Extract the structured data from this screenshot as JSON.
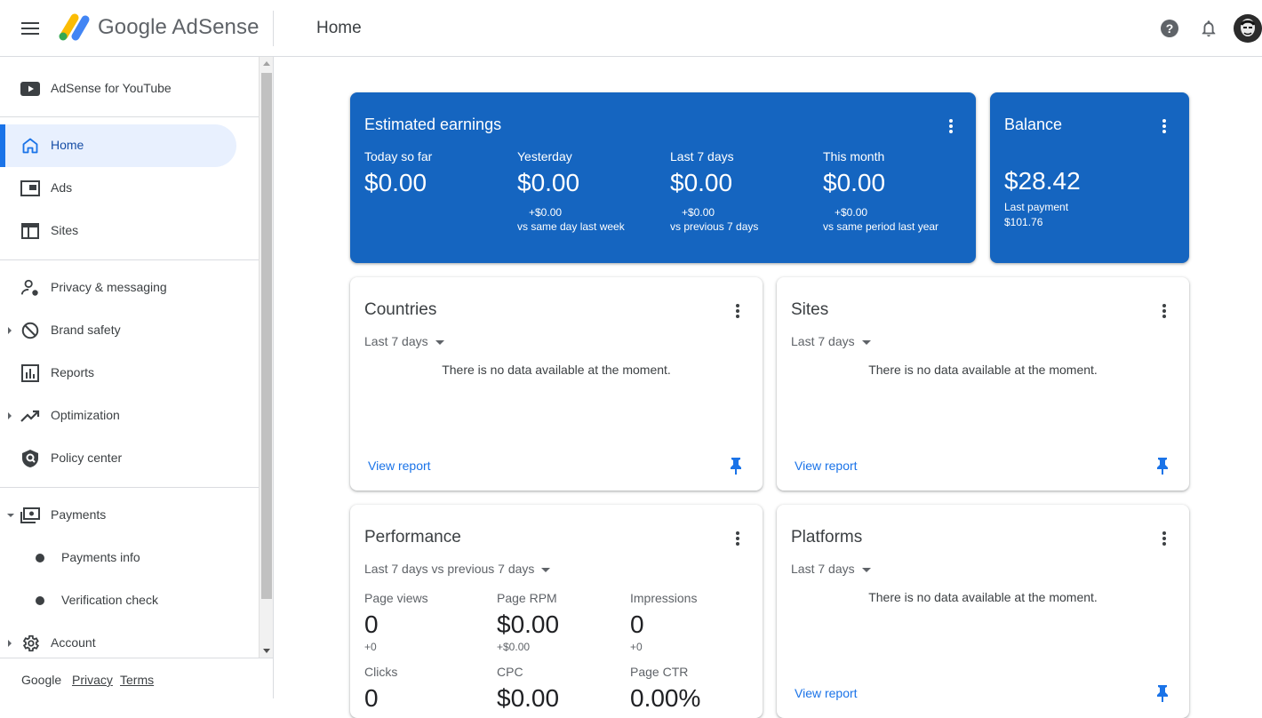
{
  "header": {
    "brand": "Google AdSense",
    "page_title": "Home"
  },
  "sidebar": {
    "items": [
      {
        "label": "AdSense for YouTube",
        "icon": "youtube-icon"
      },
      {
        "label": "Home",
        "icon": "home-icon",
        "active": true
      },
      {
        "label": "Ads",
        "icon": "ads-icon"
      },
      {
        "label": "Sites",
        "icon": "sites-icon"
      },
      {
        "label": "Privacy & messaging",
        "icon": "person-settings-icon"
      },
      {
        "label": "Brand safety",
        "icon": "block-icon"
      },
      {
        "label": "Reports",
        "icon": "reports-icon"
      },
      {
        "label": "Optimization",
        "icon": "trending-up-icon"
      },
      {
        "label": "Policy center",
        "icon": "shield-icon"
      },
      {
        "label": "Payments",
        "icon": "payments-icon"
      },
      {
        "label": "Payments info"
      },
      {
        "label": "Verification check"
      },
      {
        "label": "Account",
        "icon": "gear-icon"
      }
    ]
  },
  "footer": {
    "google": "Google",
    "privacy": "Privacy",
    "terms": "Terms"
  },
  "earnings": {
    "title": "Estimated earnings",
    "metrics": [
      {
        "label": "Today so far",
        "value": "$0.00",
        "delta": "",
        "compare": ""
      },
      {
        "label": "Yesterday",
        "value": "$0.00",
        "delta": "+$0.00",
        "compare": "vs same day last week"
      },
      {
        "label": "Last 7 days",
        "value": "$0.00",
        "delta": "+$0.00",
        "compare": "vs previous 7 days"
      },
      {
        "label": "This month",
        "value": "$0.00",
        "delta": "+$0.00",
        "compare": "vs same period last year"
      }
    ]
  },
  "balance": {
    "title": "Balance",
    "amount": "$28.42",
    "last_payment_label": "Last payment",
    "last_payment_value": "$101.76"
  },
  "countries": {
    "title": "Countries",
    "period": "Last 7 days",
    "message": "There is no data available at the moment.",
    "link": "View report"
  },
  "sites": {
    "title": "Sites",
    "period": "Last 7 days",
    "message": "There is no data available at the moment.",
    "link": "View report"
  },
  "performance": {
    "title": "Performance",
    "period": "Last 7 days vs previous 7 days",
    "metrics": [
      {
        "label": "Page views",
        "value": "0",
        "delta": "+0"
      },
      {
        "label": "Page RPM",
        "value": "$0.00",
        "delta": "+$0.00"
      },
      {
        "label": "Impressions",
        "value": "0",
        "delta": "+0"
      },
      {
        "label": "Clicks",
        "value": "0",
        "delta": ""
      },
      {
        "label": "CPC",
        "value": "$0.00",
        "delta": ""
      },
      {
        "label": "Page CTR",
        "value": "0.00%",
        "delta": ""
      }
    ]
  },
  "platforms": {
    "title": "Platforms",
    "period": "Last 7 days",
    "message": "There is no data available at the moment.",
    "link": "View report"
  },
  "colors": {
    "brand_blue": "#1565c0",
    "link_blue": "#1a73e8",
    "active_bg": "#e8f0fe"
  }
}
